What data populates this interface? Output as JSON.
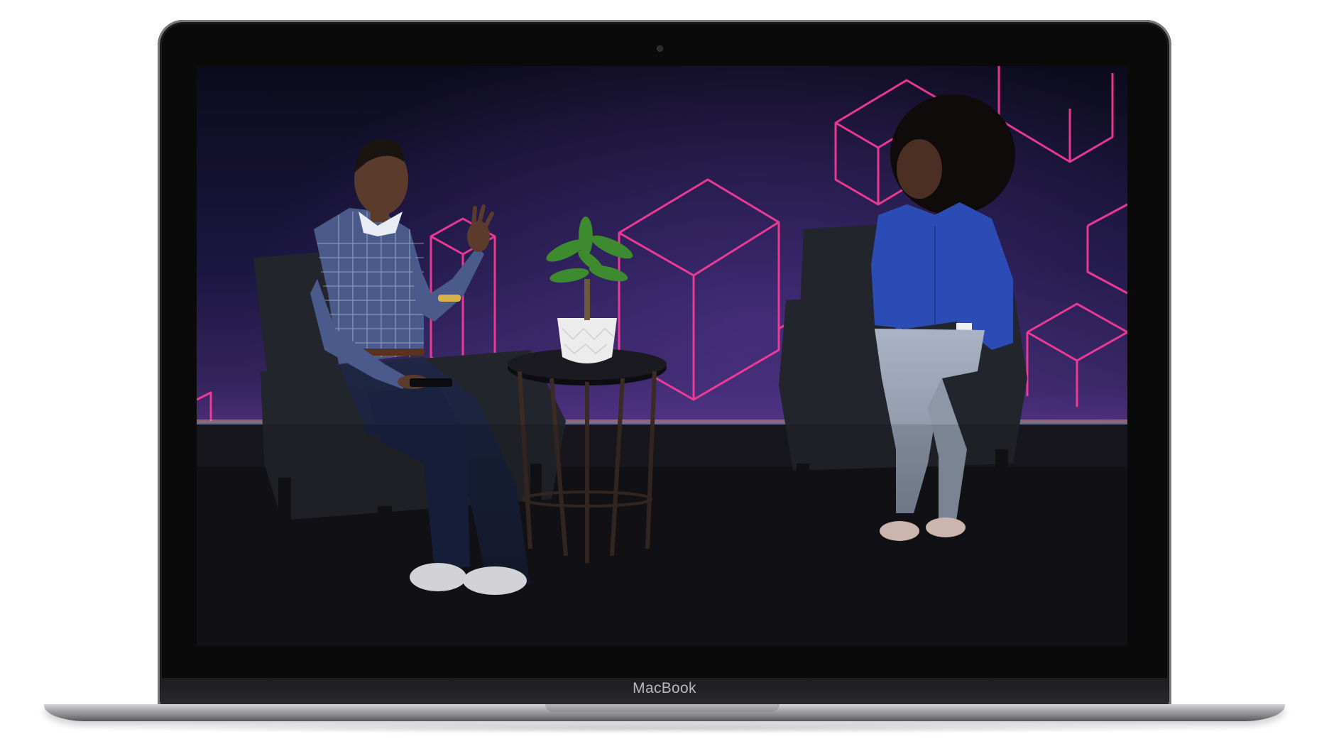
{
  "device": {
    "brand_label": "MacBook",
    "body_color": "#8c8c90",
    "bezel_color": "#0a0a0a"
  },
  "scene": {
    "backdrop_color": "#2a1e4a",
    "neon_color": "#ff3c9a",
    "floor_color": "#1a1a1e",
    "left_person_shirt": "#4a5a8a",
    "right_person_shirt": "#2b4bb5",
    "chair_color": "#23252c",
    "plant_color": "#3e8a2e"
  }
}
